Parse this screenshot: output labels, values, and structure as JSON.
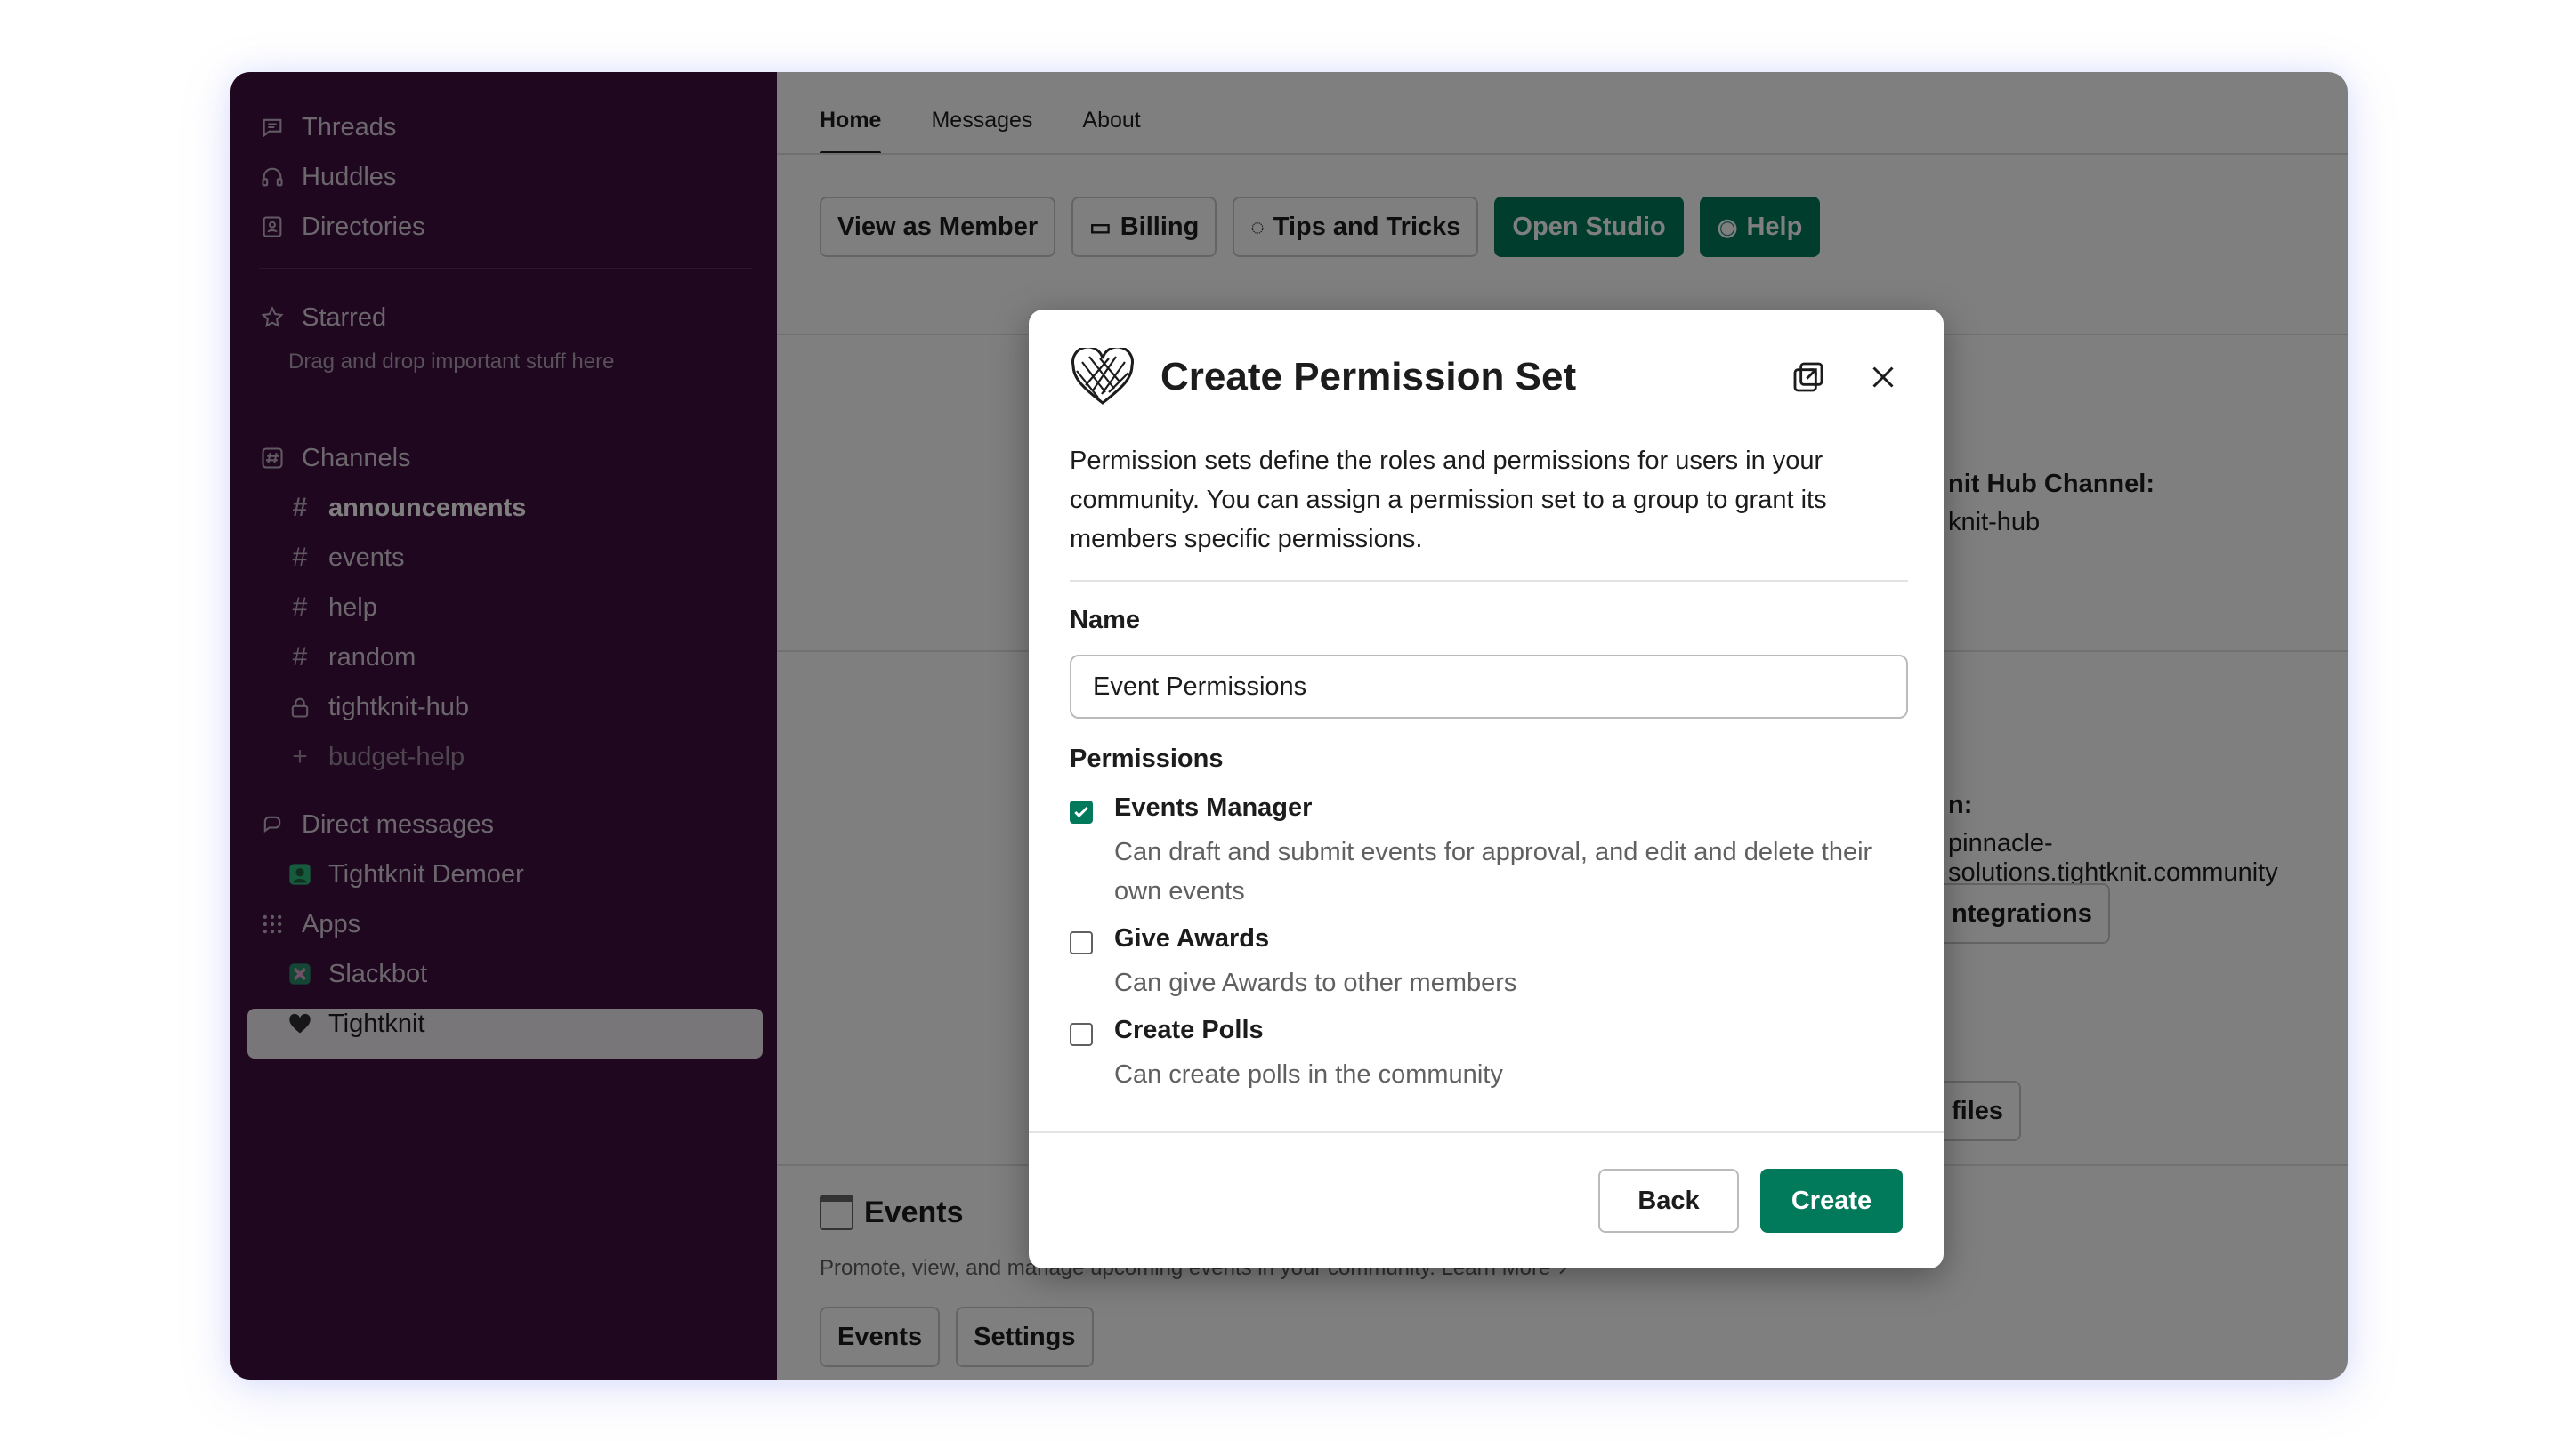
{
  "sidebar": {
    "nav": [
      {
        "label": "Threads",
        "icon": "threads-icon"
      },
      {
        "label": "Huddles",
        "icon": "headphones-icon"
      },
      {
        "label": "Directories",
        "icon": "directory-icon"
      }
    ],
    "starred": {
      "label": "Starred",
      "hint": "Drag and drop important stuff here"
    },
    "channels_label": "Channels",
    "channels": [
      {
        "label": "announcements",
        "icon": "hash-icon"
      },
      {
        "label": "events",
        "icon": "hash-icon"
      },
      {
        "label": "help",
        "icon": "hash-icon"
      },
      {
        "label": "random",
        "icon": "hash-icon"
      },
      {
        "label": "tightknit-hub",
        "icon": "lock-icon"
      },
      {
        "label": "budget-help",
        "icon": "plus-icon"
      }
    ],
    "dm_label": "Direct messages",
    "dms": [
      {
        "label": "Tightknit Demoer"
      }
    ],
    "apps_label": "Apps",
    "apps": [
      {
        "label": "Slackbot"
      },
      {
        "label": "Tightknit"
      }
    ]
  },
  "main": {
    "tabs": [
      "Home",
      "Messages",
      "About"
    ],
    "buttons": [
      "View as Member",
      "Billing",
      "Tips and Tricks",
      "Open Studio",
      "Help"
    ],
    "hub_channel_label": "nit Hub Channel:",
    "hub_channel_value": "knit-hub",
    "domain_label": "n:",
    "domain_value": "pinnacle-solutions.tightknit.community",
    "integrations_label": "ntegrations",
    "profiles_label": "files",
    "events": {
      "title": "Events",
      "desc": "Promote, view, and manage upcoming events in your community.",
      "learn_more": "Learn More ↗",
      "buttons": [
        "Events",
        "Settings"
      ]
    }
  },
  "modal": {
    "title": "Create Permission Set",
    "description": "Permission sets define the roles and permissions for users in your community. You can assign a permission set to a group to grant its members specific permissions.",
    "name_label": "Name",
    "name_value": "Event Permissions",
    "permissions_label": "Permissions",
    "permissions": [
      {
        "title": "Events Manager",
        "desc": "Can draft and submit events for approval, and edit and delete their own events",
        "checked": true
      },
      {
        "title": "Give Awards",
        "desc": "Can give Awards to other members",
        "checked": false
      },
      {
        "title": "Create Polls",
        "desc": "Can create polls in the community",
        "checked": false
      }
    ],
    "back_label": "Back",
    "create_label": "Create"
  },
  "colors": {
    "sidebar_bg": "#3f0e40",
    "accent_green": "#007a5a"
  }
}
